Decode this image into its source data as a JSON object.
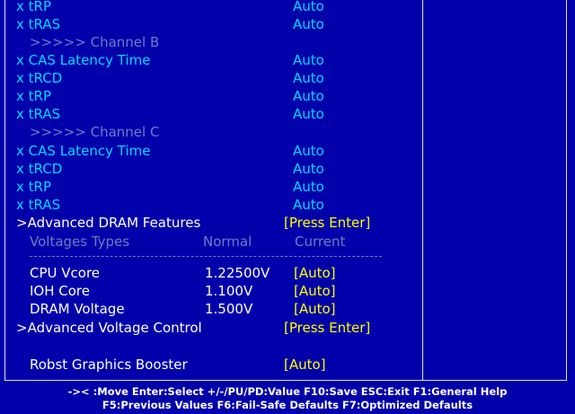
{
  "rows": [
    {
      "prefix": "x",
      "label": "tRP",
      "value": "Auto"
    },
    {
      "prefix": "x",
      "label": "tRAS",
      "value": "Auto"
    },
    {
      "label": ">>>>> Channel B"
    },
    {
      "prefix": "x",
      "label": "CAS Latency Time",
      "value": "Auto"
    },
    {
      "prefix": "x",
      "label": "tRCD",
      "value": "Auto"
    },
    {
      "prefix": "x",
      "label": "tRP",
      "value": "Auto"
    },
    {
      "prefix": "x",
      "label": "tRAS",
      "value": "Auto"
    },
    {
      "label": ">>>>> Channel C"
    },
    {
      "prefix": "x",
      "label": "CAS Latency Time",
      "value": "Auto"
    },
    {
      "prefix": "x",
      "label": "tRCD",
      "value": "Auto"
    },
    {
      "prefix": "x",
      "label": "tRP",
      "value": "Auto"
    },
    {
      "prefix": "x",
      "label": "tRAS",
      "value": "Auto"
    }
  ],
  "advanced_dram": {
    "prefix": ">",
    "label": "Advanced DRAM Features",
    "value": "[Press Enter]"
  },
  "voltage_header": {
    "type": "Voltages Types",
    "normal": "Normal",
    "current": "Current"
  },
  "voltages": [
    {
      "label": "CPU Vcore",
      "normal": "1.22500V",
      "value": "[Auto]"
    },
    {
      "label": "IOH Core",
      "normal": "1.100V",
      "value": "[Auto]"
    },
    {
      "label": "DRAM Voltage",
      "normal": "1.500V",
      "value": "[Auto]"
    }
  ],
  "advanced_voltage": {
    "prefix": ">",
    "label": "Advanced Voltage Control",
    "value": "[Press Enter]"
  },
  "robst": {
    "label": "Robst Graphics Booster",
    "value": "[Auto]"
  },
  "footer": {
    "line1": "->< :Move  Enter:Select  +/-/PU/PD:Value  F10:Save  ESC:Exit  F1:General Help",
    "line2": "F5:Previous Values  F6:Fail-Safe Defaults  F7:Optimized Defaults"
  },
  "colors": {
    "background": "#0000aa",
    "disabled": "#00d8ff",
    "subheader": "#6c7cc4",
    "selectable": "#ffff00",
    "text": "#ffffff"
  }
}
